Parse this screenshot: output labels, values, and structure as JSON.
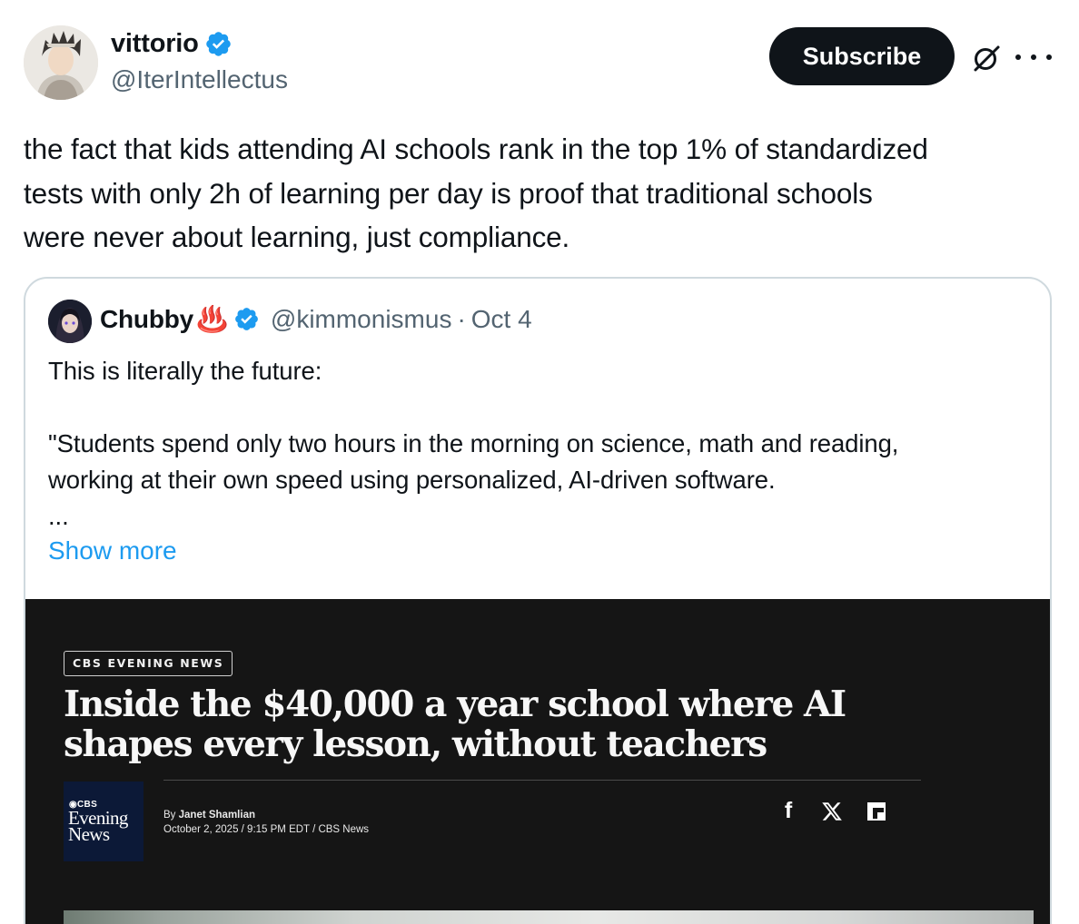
{
  "author": {
    "name": "vittorio",
    "handle": "@IterIntellectus"
  },
  "actions": {
    "subscribe_label": "Subscribe",
    "grok_icon": "grok-icon",
    "more_icon": "more-icon"
  },
  "tweet": {
    "lines": [
      "the fact that kids attending AI schools rank in the top 1% of standardized",
      "tests with only 2h of learning per day is proof that traditional schools",
      "were never about learning, just compliance."
    ]
  },
  "quote": {
    "name": "Chubby",
    "emoji": "♨️",
    "handle": "@kimmonismus",
    "separator": "·",
    "date": "Oct 4",
    "lines": [
      "This is literally the future:",
      "",
      "\"Students spend only two hours in the morning on science, math and reading,",
      "working at their own speed using personalized, AI-driven software.",
      "..."
    ],
    "show_more": "Show more"
  },
  "media": {
    "tag": "CBS EVENING NEWS",
    "headline_lines": [
      "Inside the $40,000 a year school where AI",
      "shapes every lesson, without teachers"
    ],
    "logo": {
      "mark": "◉CBS",
      "word1": "Evening",
      "word2": "News"
    },
    "byline_prefix": "By ",
    "author": "Janet Shamlian",
    "dateline": "October 2, 2025 / 9:15 PM EDT / CBS News",
    "share": {
      "facebook": "f",
      "x_icon": "x-icon",
      "flipboard_icon": "flipboard-icon"
    }
  },
  "colors": {
    "accent": "#1d9bf0",
    "text": "#0f1419",
    "muted": "#536471",
    "border": "#cfd9de",
    "button_bg": "#0f1419",
    "media_bg": "#151515",
    "cbs_logo_bg": "#0c1937"
  }
}
